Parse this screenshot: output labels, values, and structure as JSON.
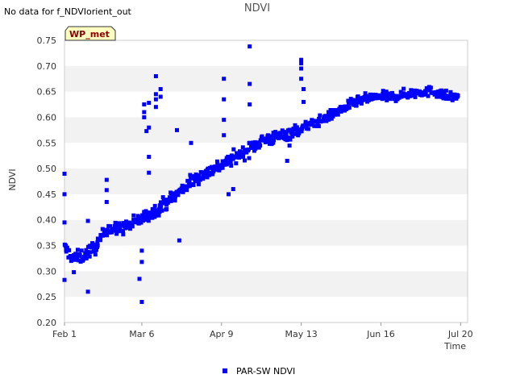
{
  "status_note": "No data for f_NDVIorient_out",
  "chart_data": {
    "type": "scatter",
    "title": "NDVI",
    "xlabel": "Time",
    "ylabel": "NDVI",
    "badge": "WP_met",
    "xlim": [
      0,
      172
    ],
    "ylim": [
      0.2,
      0.75
    ],
    "x_ticks": [
      {
        "label": "Feb 1",
        "day": 0
      },
      {
        "label": "Mar 6",
        "day": 33
      },
      {
        "label": "Apr 9",
        "day": 67
      },
      {
        "label": "May 13",
        "day": 101
      },
      {
        "label": "Jun 16",
        "day": 135
      },
      {
        "label": "Jul 20",
        "day": 169
      }
    ],
    "y_ticks": [
      "0.20",
      "0.25",
      "0.30",
      "0.35",
      "0.40",
      "0.45",
      "0.50",
      "0.55",
      "0.60",
      "0.65",
      "0.70",
      "0.75"
    ],
    "grid": "alternating horizontal bands",
    "legend_position": "bottom-center",
    "colors": {
      "series": "#0000ff",
      "band": "#f2f2f2",
      "badge_bg": "#ffffc0"
    },
    "series": [
      {
        "name": "PAR-SW NDVI",
        "marker": "square",
        "trend": [
          [
            0,
            0.345
          ],
          [
            4,
            0.325
          ],
          [
            8,
            0.33
          ],
          [
            14,
            0.35
          ],
          [
            18,
            0.385
          ],
          [
            22,
            0.38
          ],
          [
            28,
            0.39
          ],
          [
            32,
            0.4
          ],
          [
            36,
            0.41
          ],
          [
            42,
            0.43
          ],
          [
            48,
            0.45
          ],
          [
            54,
            0.475
          ],
          [
            60,
            0.49
          ],
          [
            66,
            0.505
          ],
          [
            72,
            0.52
          ],
          [
            78,
            0.535
          ],
          [
            84,
            0.555
          ],
          [
            90,
            0.56
          ],
          [
            96,
            0.57
          ],
          [
            100,
            0.575
          ],
          [
            104,
            0.585
          ],
          [
            110,
            0.595
          ],
          [
            116,
            0.61
          ],
          [
            122,
            0.625
          ],
          [
            128,
            0.635
          ],
          [
            134,
            0.64
          ],
          [
            140,
            0.64
          ],
          [
            146,
            0.645
          ],
          [
            152,
            0.65
          ],
          [
            158,
            0.65
          ],
          [
            164,
            0.64
          ],
          [
            168,
            0.64
          ]
        ],
        "outliers": [
          [
            0,
            0.49
          ],
          [
            0,
            0.45
          ],
          [
            0,
            0.395
          ],
          [
            0,
            0.283
          ],
          [
            4,
            0.298
          ],
          [
            10,
            0.26
          ],
          [
            10,
            0.398
          ],
          [
            18,
            0.478
          ],
          [
            18,
            0.458
          ],
          [
            18,
            0.435
          ],
          [
            32,
            0.285
          ],
          [
            33,
            0.24
          ],
          [
            33,
            0.318
          ],
          [
            33,
            0.34
          ],
          [
            34,
            0.6
          ],
          [
            34,
            0.61
          ],
          [
            34,
            0.625
          ],
          [
            35,
            0.573
          ],
          [
            36,
            0.58
          ],
          [
            36,
            0.628
          ],
          [
            36,
            0.523
          ],
          [
            36,
            0.492
          ],
          [
            39,
            0.68
          ],
          [
            39,
            0.645
          ],
          [
            39,
            0.635
          ],
          [
            39,
            0.62
          ],
          [
            41,
            0.655
          ],
          [
            41,
            0.64
          ],
          [
            48,
            0.575
          ],
          [
            49,
            0.36
          ],
          [
            54,
            0.55
          ],
          [
            68,
            0.675
          ],
          [
            68,
            0.635
          ],
          [
            68,
            0.595
          ],
          [
            68,
            0.565
          ],
          [
            70,
            0.45
          ],
          [
            72,
            0.46
          ],
          [
            79,
            0.738
          ],
          [
            79,
            0.665
          ],
          [
            79,
            0.625
          ],
          [
            95,
            0.515
          ],
          [
            96,
            0.545
          ],
          [
            101,
            0.712
          ],
          [
            101,
            0.705
          ],
          [
            101,
            0.695
          ],
          [
            101,
            0.675
          ],
          [
            102,
            0.655
          ],
          [
            102,
            0.63
          ]
        ]
      }
    ]
  }
}
